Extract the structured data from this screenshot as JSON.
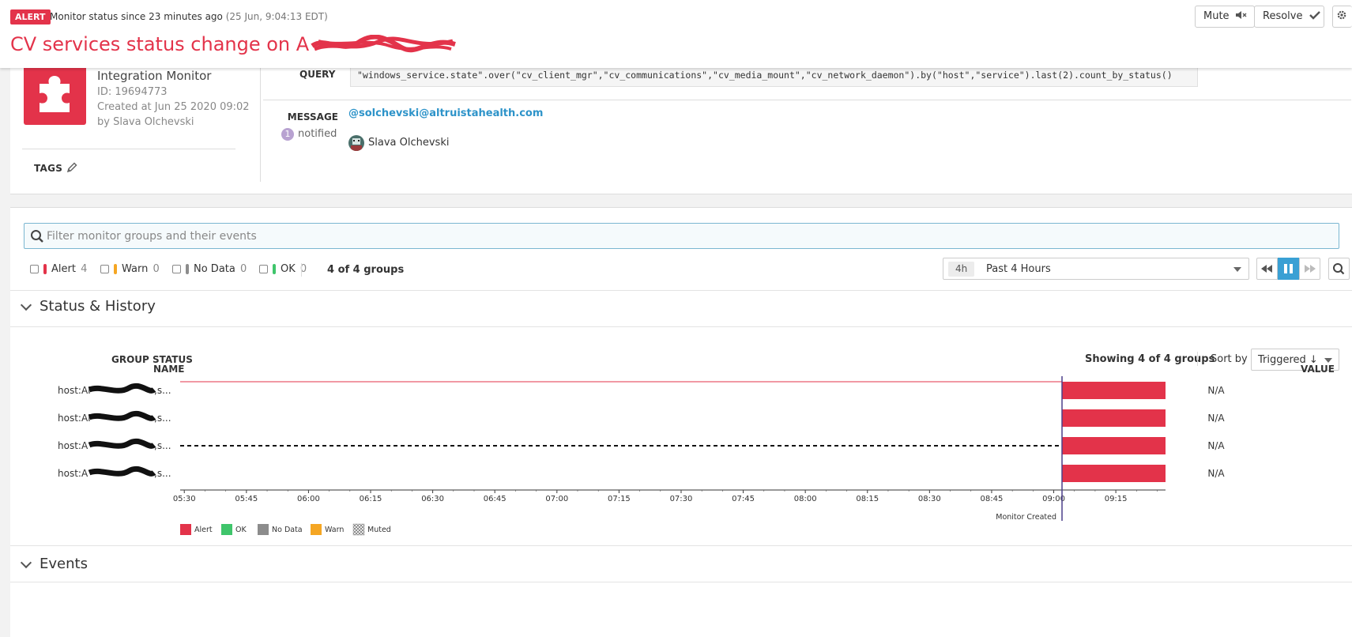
{
  "header": {
    "badge": "ALERT",
    "status_text": "Monitor status since 23 minutes ago",
    "status_time": "(25 Jun, 9:04:13 EDT)",
    "title": "CV services status change on A",
    "mute_label": "Mute",
    "resolve_label": "Resolve"
  },
  "monitor": {
    "type": "Integration Monitor",
    "id": "ID: 19694773",
    "created": "Created at Jun 25 2020 09:02",
    "by": "by Slava Olchevski",
    "tags_label": "TAGS",
    "query_label": "QUERY",
    "query": "\"windows_service.state\".over(\"cv_client_mgr\",\"cv_communications\",\"cv_media_mount\",\"cv_network_daemon\").by(\"host\",\"service\").last(2).count_by_status()",
    "message_label": "MESSAGE",
    "notified_count": "1",
    "notified_label": "notified",
    "message_handle": "@solchevski@altruistahealth.com",
    "user_name": "Slava Olchevski"
  },
  "filters": {
    "search_placeholder": "Filter monitor groups and their events",
    "statuses": [
      {
        "label": "Alert",
        "count": "4",
        "color": "#e3334a"
      },
      {
        "label": "Warn",
        "count": "0",
        "color": "#f5a623"
      },
      {
        "label": "No Data",
        "count": "0",
        "color": "#8c8c8c"
      },
      {
        "label": "OK",
        "count": "0",
        "color": "#3fc56b"
      }
    ],
    "groups_count": "4 of 4 groups",
    "time_chip": "4h",
    "time_label": "Past 4 Hours"
  },
  "status_history": {
    "section_title": "Status & History",
    "group_status_label": "GROUP STATUS",
    "showing": "Showing 4 of 4 groups",
    "sort_by_label": "Sort by",
    "sort_value": "Triggered ↓",
    "col_name": "NAME",
    "col_value": "VALUE"
  },
  "events": {
    "section_title": "Events"
  },
  "chart_data": {
    "type": "timeline",
    "x_ticks": [
      "05:30",
      "05:45",
      "06:00",
      "06:15",
      "06:30",
      "06:45",
      "07:00",
      "07:15",
      "07:30",
      "07:45",
      "08:00",
      "08:15",
      "08:30",
      "08:45",
      "09:00",
      "09:15"
    ],
    "marker": {
      "label": "Monitor Created",
      "time": "09:02"
    },
    "range_end": "09:27",
    "groups": [
      {
        "name": "host:AF",
        "suffix": ",s...",
        "status": "Alert",
        "value": "N/A",
        "pre": "solid"
      },
      {
        "name": "host:AF",
        "suffix": ",s...",
        "status": "Alert",
        "value": "N/A",
        "pre": "none"
      },
      {
        "name": "host:A",
        "suffix": ",s...",
        "status": "Alert",
        "value": "N/A",
        "pre": "dashed"
      },
      {
        "name": "host:A",
        "suffix": ",s...",
        "status": "Alert",
        "value": "N/A",
        "pre": "none"
      }
    ],
    "legend": [
      {
        "label": "Alert",
        "color": "#e3334a"
      },
      {
        "label": "OK",
        "color": "#3fc56b"
      },
      {
        "label": "No Data",
        "color": "#8c8c8c"
      },
      {
        "label": "Warn",
        "color": "#f5a623"
      },
      {
        "label": "Muted",
        "color": "hatch"
      }
    ]
  }
}
